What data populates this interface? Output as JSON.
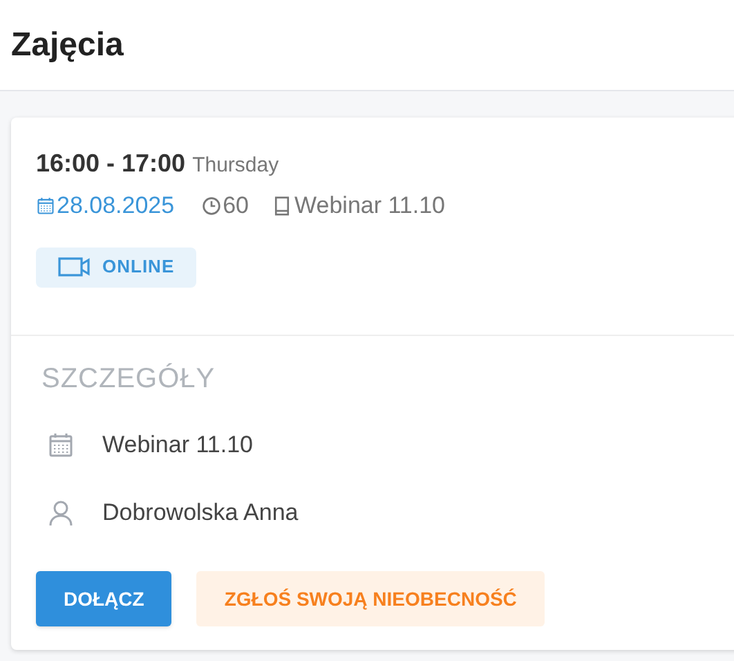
{
  "header": {
    "title": "Zajęcia"
  },
  "event": {
    "time": "16:00 - 17:00",
    "day": "Thursday",
    "date": "28.08.2025",
    "duration": "60",
    "course": "Webinar 11.10",
    "mode": "ONLINE"
  },
  "details": {
    "title": "SZCZEGÓŁY",
    "items": [
      {
        "kind": "calendar",
        "text": "Webinar 11.10"
      },
      {
        "kind": "person",
        "text": "Dobrowolska Anna"
      }
    ]
  },
  "buttons": [
    {
      "kind": "primary",
      "label": "DOŁĄCZ"
    },
    {
      "kind": "secondary",
      "label": "ZGŁOŚ SWOJĄ NIEOBECNOŚĆ"
    }
  ]
}
